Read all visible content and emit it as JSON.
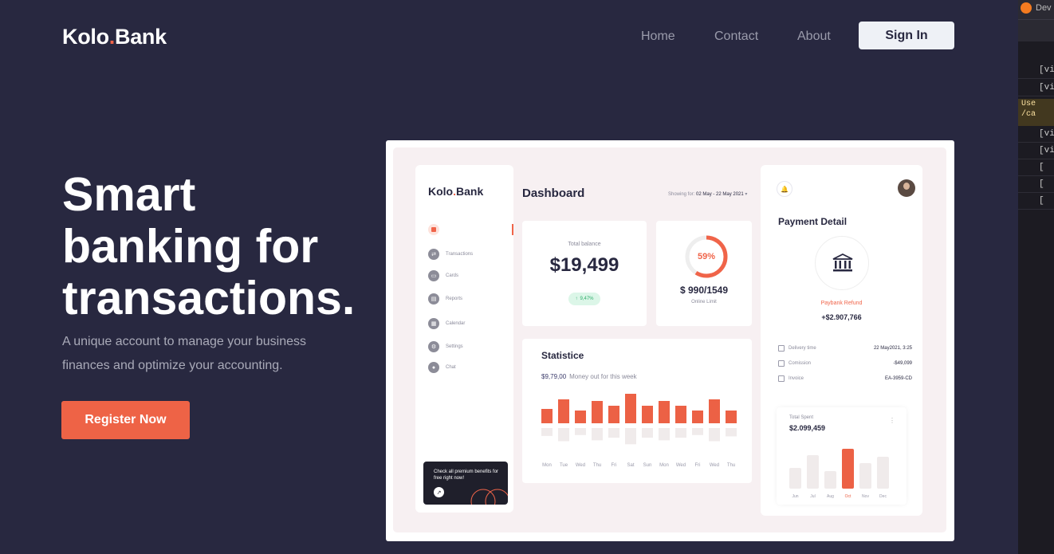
{
  "header": {
    "logo_text": "Kolo",
    "logo_dot": ".",
    "logo_suffix": "Bank",
    "nav": [
      "Home",
      "Contact",
      "About"
    ],
    "signin_label": "Sign In"
  },
  "hero": {
    "line1": "Smart",
    "line2": "banking for",
    "line3": "transactions.",
    "subtitle": "A unique account to manage your business finances and optimize your accounting.",
    "cta_label": "Register Now"
  },
  "dashboard": {
    "brand": "Kolo",
    "brand_dot": ".",
    "brand_suffix": "Bank",
    "sidebar": [
      "Transactions",
      "Cards",
      "Reports",
      "Calendar",
      "Settings",
      "Chat"
    ],
    "promo_text": "Check all premium benefits for free right now!",
    "promo_btn": "↗",
    "title": "Dashboard",
    "showing_label": "Showing for:",
    "showing_range": "02 May - 22 May 2021",
    "balance_label": "Total balance",
    "balance_value": "$19,499",
    "balance_change": "9,47%",
    "limit_pct": "59%",
    "limit_pct_value": 59,
    "limit_amount": "$ 990/1549",
    "limit_label": "Online Limit",
    "stat_title": "Statistice",
    "stat_money": "$9,79,00",
    "stat_money_label": "Money out for this week",
    "chart_data": {
      "type": "bar",
      "categories": [
        "Mon",
        "Tue",
        "Wed",
        "Thu",
        "Fri",
        "Sat",
        "Sun",
        "Mon",
        "Wed",
        "Fri",
        "Wed",
        "Thu",
        "Fri"
      ],
      "series": [
        {
          "values": [
            18,
            30,
            16,
            28,
            22,
            37,
            22,
            28,
            22,
            16,
            30,
            16
          ]
        },
        {
          "values": [
            18,
            30,
            16,
            28,
            22,
            37,
            22,
            28,
            22,
            16,
            30,
            19
          ]
        }
      ]
    },
    "payment_title": "Payment Detail",
    "refund_label": "Paybank Refund",
    "refund_amount": "+$2.907,766",
    "details": [
      {
        "label": "Delivery time",
        "value": "22 May2021, 3:25"
      },
      {
        "label": "Comission",
        "value": "-$49,099"
      },
      {
        "label": "Invoice",
        "value": "EA-3959-CD"
      }
    ],
    "spent_label": "Total Spent",
    "spent_value": "$2.099,459",
    "spent_chart": {
      "type": "bar",
      "categories": [
        "Jun",
        "Jul",
        "Aug",
        "Oct",
        "Nov",
        "Dec"
      ],
      "values": [
        26,
        42,
        22,
        50,
        32,
        40
      ],
      "highlight": "Oct"
    },
    "accent": "#f06449"
  },
  "devtools": {
    "title": "Dev",
    "lines": [
      "[vi",
      "[vi",
      "[vi",
      "[vi",
      "[",
      "[",
      "["
    ],
    "warning": "Use /ca"
  }
}
